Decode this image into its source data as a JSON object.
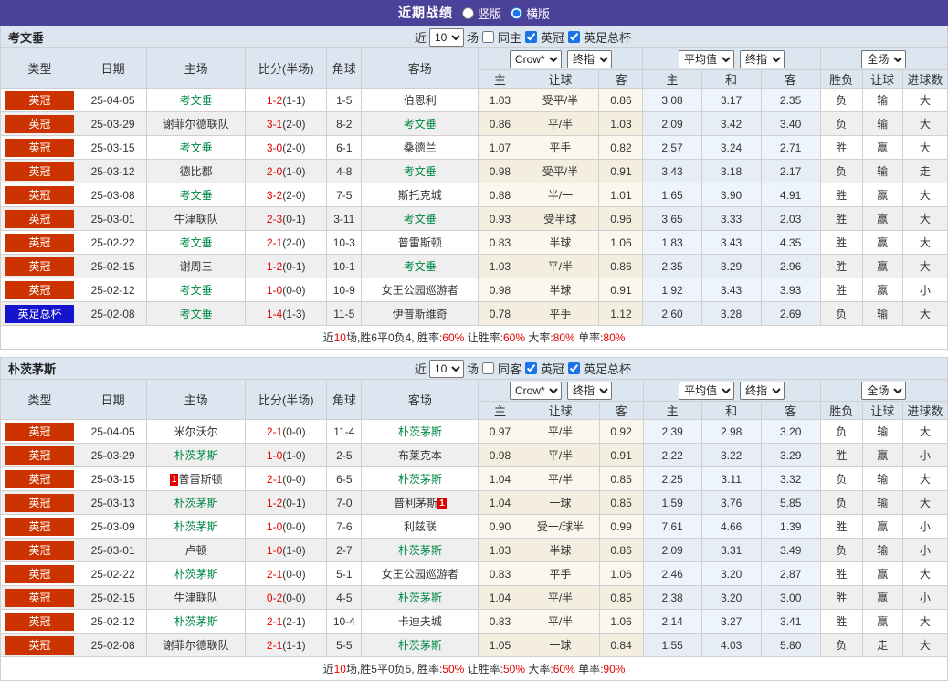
{
  "title_bar": {
    "title": "近期战绩",
    "options": [
      {
        "label": "竖版",
        "selected": false
      },
      {
        "label": "横版",
        "selected": true
      }
    ]
  },
  "colors": {
    "header_purple": "#4c4199",
    "league_badge_red": "#cc3300",
    "cup_badge_blue": "#1414cc",
    "win_red": "#e60000",
    "loss_blue": "#0000cc",
    "push_green": "#009933",
    "team_highlight_green": "#008844"
  },
  "tables": [
    {
      "labels": {
        "team": "考文垂",
        "near_label": "近",
        "near_value": "10",
        "matches_label": "场",
        "same_label": "同主",
        "league_label": "英冠",
        "cup_label": "英足总杯",
        "h_type": "类型",
        "h_date": "日期",
        "h_home": "主场",
        "h_score": "比分(半场)",
        "h_corner": "角球",
        "h_away": "客场",
        "book": "Crow*",
        "book_time": "终指",
        "avg": "平均值",
        "avg_time": "终指",
        "scope": "全场",
        "sub": [
          "主",
          "让球",
          "客",
          "主",
          "和",
          "客",
          "胜负",
          "让球",
          "进球数"
        ]
      },
      "filters": {
        "same_checked": false,
        "league_checked": true,
        "cup_checked": true
      },
      "rows": [
        {
          "type": "英冠",
          "cup": false,
          "date": "25-04-05",
          "home": {
            "name": "考文垂",
            "hl": true
          },
          "ft": "1-2",
          "ht": "(1-1)",
          "corner": "1-5",
          "away": {
            "name": "伯恩利",
            "hl": false
          },
          "odds": [
            "1.03",
            "受平/半",
            "0.86"
          ],
          "avg": [
            "3.08",
            "3.17",
            "2.35"
          ],
          "res": [
            "负",
            "输",
            "大"
          ]
        },
        {
          "type": "英冠",
          "cup": false,
          "date": "25-03-29",
          "home": {
            "name": "谢菲尔德联队",
            "hl": false
          },
          "ft": "3-1",
          "ht": "(2-0)",
          "corner": "8-2",
          "away": {
            "name": "考文垂",
            "hl": true
          },
          "odds": [
            "0.86",
            "平/半",
            "1.03"
          ],
          "avg": [
            "2.09",
            "3.42",
            "3.40"
          ],
          "res": [
            "负",
            "输",
            "大"
          ]
        },
        {
          "type": "英冠",
          "cup": false,
          "date": "25-03-15",
          "home": {
            "name": "考文垂",
            "hl": true
          },
          "ft": "3-0",
          "ht": "(2-0)",
          "corner": "6-1",
          "away": {
            "name": "桑德兰",
            "hl": false
          },
          "odds": [
            "1.07",
            "平手",
            "0.82"
          ],
          "avg": [
            "2.57",
            "3.24",
            "2.71"
          ],
          "res": [
            "胜",
            "赢",
            "大"
          ]
        },
        {
          "type": "英冠",
          "cup": false,
          "date": "25-03-12",
          "home": {
            "name": "德比郡",
            "hl": false
          },
          "ft": "2-0",
          "ht": "(1-0)",
          "corner": "4-8",
          "away": {
            "name": "考文垂",
            "hl": true
          },
          "odds": [
            "0.98",
            "受平/半",
            "0.91"
          ],
          "avg": [
            "3.43",
            "3.18",
            "2.17"
          ],
          "res": [
            "负",
            "输",
            "走"
          ]
        },
        {
          "type": "英冠",
          "cup": false,
          "date": "25-03-08",
          "home": {
            "name": "考文垂",
            "hl": true
          },
          "ft": "3-2",
          "ht": "(2-0)",
          "corner": "7-5",
          "away": {
            "name": "斯托克城",
            "hl": false
          },
          "odds": [
            "0.88",
            "半/一",
            "1.01"
          ],
          "avg": [
            "1.65",
            "3.90",
            "4.91"
          ],
          "res": [
            "胜",
            "赢",
            "大"
          ]
        },
        {
          "type": "英冠",
          "cup": false,
          "date": "25-03-01",
          "home": {
            "name": "牛津联队",
            "hl": false
          },
          "ft": "2-3",
          "ht": "(0-1)",
          "corner": "3-11",
          "away": {
            "name": "考文垂",
            "hl": true
          },
          "odds": [
            "0.93",
            "受半球",
            "0.96"
          ],
          "avg": [
            "3.65",
            "3.33",
            "2.03"
          ],
          "res": [
            "胜",
            "赢",
            "大"
          ]
        },
        {
          "type": "英冠",
          "cup": false,
          "date": "25-02-22",
          "home": {
            "name": "考文垂",
            "hl": true
          },
          "ft": "2-1",
          "ht": "(2-0)",
          "corner": "10-3",
          "away": {
            "name": "普雷斯顿",
            "hl": false
          },
          "odds": [
            "0.83",
            "半球",
            "1.06"
          ],
          "avg": [
            "1.83",
            "3.43",
            "4.35"
          ],
          "res": [
            "胜",
            "赢",
            "大"
          ]
        },
        {
          "type": "英冠",
          "cup": false,
          "date": "25-02-15",
          "home": {
            "name": "谢周三",
            "hl": false
          },
          "ft": "1-2",
          "ht": "(0-1)",
          "corner": "10-1",
          "away": {
            "name": "考文垂",
            "hl": true
          },
          "odds": [
            "1.03",
            "平/半",
            "0.86"
          ],
          "avg": [
            "2.35",
            "3.29",
            "2.96"
          ],
          "res": [
            "胜",
            "赢",
            "大"
          ]
        },
        {
          "type": "英冠",
          "cup": false,
          "date": "25-02-12",
          "home": {
            "name": "考文垂",
            "hl": true
          },
          "ft": "1-0",
          "ht": "(0-0)",
          "corner": "10-9",
          "away": {
            "name": "女王公园巡游者",
            "hl": false
          },
          "odds": [
            "0.98",
            "半球",
            "0.91"
          ],
          "avg": [
            "1.92",
            "3.43",
            "3.93"
          ],
          "res": [
            "胜",
            "赢",
            "小"
          ]
        },
        {
          "type": "英足总杯",
          "cup": true,
          "date": "25-02-08",
          "home": {
            "name": "考文垂",
            "hl": true
          },
          "ft": "1-4",
          "ht": "(1-3)",
          "corner": "11-5",
          "away": {
            "name": "伊普斯维奇",
            "hl": false
          },
          "odds": [
            "0.78",
            "平手",
            "1.12"
          ],
          "avg": [
            "2.60",
            "3.28",
            "2.69"
          ],
          "res": [
            "负",
            "输",
            "大"
          ]
        }
      ],
      "summary": [
        [
          "近",
          "k"
        ],
        [
          "10",
          "r"
        ],
        [
          "场,胜6平0负4, 胜率:",
          "k"
        ],
        [
          "60%",
          "r"
        ],
        [
          " 让胜率:",
          "k"
        ],
        [
          "60%",
          "r"
        ],
        [
          " 大率:",
          "k"
        ],
        [
          "80%",
          "r"
        ],
        [
          " 单率:",
          "k"
        ],
        [
          "80%",
          "r"
        ]
      ]
    },
    {
      "labels": {
        "team": "朴茨茅斯",
        "near_label": "近",
        "near_value": "10",
        "matches_label": "场",
        "same_label": "同客",
        "league_label": "英冠",
        "cup_label": "英足总杯",
        "h_type": "类型",
        "h_date": "日期",
        "h_home": "主场",
        "h_score": "比分(半场)",
        "h_corner": "角球",
        "h_away": "客场",
        "book": "Crow*",
        "book_time": "终指",
        "avg": "平均值",
        "avg_time": "终指",
        "scope": "全场",
        "sub": [
          "主",
          "让球",
          "客",
          "主",
          "和",
          "客",
          "胜负",
          "让球",
          "进球数"
        ]
      },
      "filters": {
        "same_checked": false,
        "league_checked": true,
        "cup_checked": true
      },
      "rows": [
        {
          "type": "英冠",
          "cup": false,
          "date": "25-04-05",
          "home": {
            "name": "米尔沃尔",
            "hl": false
          },
          "ft": "2-1",
          "ht": "(0-0)",
          "corner": "11-4",
          "away": {
            "name": "朴茨茅斯",
            "hl": true
          },
          "odds": [
            "0.97",
            "平/半",
            "0.92"
          ],
          "avg": [
            "2.39",
            "2.98",
            "3.20"
          ],
          "res": [
            "负",
            "输",
            "大"
          ]
        },
        {
          "type": "英冠",
          "cup": false,
          "date": "25-03-29",
          "home": {
            "name": "朴茨茅斯",
            "hl": true
          },
          "ft": "1-0",
          "ht": "(1-0)",
          "corner": "2-5",
          "away": {
            "name": "布莱克本",
            "hl": false
          },
          "odds": [
            "0.98",
            "平/半",
            "0.91"
          ],
          "avg": [
            "2.22",
            "3.22",
            "3.29"
          ],
          "res": [
            "胜",
            "赢",
            "小"
          ]
        },
        {
          "type": "英冠",
          "cup": false,
          "date": "25-03-15",
          "home": {
            "name": "普雷斯顿",
            "hl": false
          },
          "home_badge": "1",
          "ft": "2-1",
          "ht": "(0-0)",
          "corner": "6-5",
          "away": {
            "name": "朴茨茅斯",
            "hl": true
          },
          "odds": [
            "1.04",
            "平/半",
            "0.85"
          ],
          "avg": [
            "2.25",
            "3.11",
            "3.32"
          ],
          "res": [
            "负",
            "输",
            "大"
          ]
        },
        {
          "type": "英冠",
          "cup": false,
          "date": "25-03-13",
          "home": {
            "name": "朴茨茅斯",
            "hl": true
          },
          "ft": "1-2",
          "ht": "(0-1)",
          "corner": "7-0",
          "away": {
            "name": "普利茅斯",
            "hl": false
          },
          "away_badge": "1",
          "odds": [
            "1.04",
            "一球",
            "0.85"
          ],
          "avg": [
            "1.59",
            "3.76",
            "5.85"
          ],
          "res": [
            "负",
            "输",
            "大"
          ]
        },
        {
          "type": "英冠",
          "cup": false,
          "date": "25-03-09",
          "home": {
            "name": "朴茨茅斯",
            "hl": true
          },
          "ft": "1-0",
          "ht": "(0-0)",
          "corner": "7-6",
          "away": {
            "name": "利兹联",
            "hl": false
          },
          "odds": [
            "0.90",
            "受一/球半",
            "0.99"
          ],
          "avg": [
            "7.61",
            "4.66",
            "1.39"
          ],
          "res": [
            "胜",
            "赢",
            "小"
          ]
        },
        {
          "type": "英冠",
          "cup": false,
          "date": "25-03-01",
          "home": {
            "name": "卢顿",
            "hl": false
          },
          "ft": "1-0",
          "ht": "(1-0)",
          "corner": "2-7",
          "away": {
            "name": "朴茨茅斯",
            "hl": true
          },
          "odds": [
            "1.03",
            "半球",
            "0.86"
          ],
          "avg": [
            "2.09",
            "3.31",
            "3.49"
          ],
          "res": [
            "负",
            "输",
            "小"
          ]
        },
        {
          "type": "英冠",
          "cup": false,
          "date": "25-02-22",
          "home": {
            "name": "朴茨茅斯",
            "hl": true
          },
          "ft": "2-1",
          "ht": "(0-0)",
          "corner": "5-1",
          "away": {
            "name": "女王公园巡游者",
            "hl": false
          },
          "odds": [
            "0.83",
            "平手",
            "1.06"
          ],
          "avg": [
            "2.46",
            "3.20",
            "2.87"
          ],
          "res": [
            "胜",
            "赢",
            "大"
          ]
        },
        {
          "type": "英冠",
          "cup": false,
          "date": "25-02-15",
          "home": {
            "name": "牛津联队",
            "hl": false
          },
          "ft": "0-2",
          "ht": "(0-0)",
          "corner": "4-5",
          "away": {
            "name": "朴茨茅斯",
            "hl": true
          },
          "odds": [
            "1.04",
            "平/半",
            "0.85"
          ],
          "avg": [
            "2.38",
            "3.20",
            "3.00"
          ],
          "res": [
            "胜",
            "赢",
            "小"
          ]
        },
        {
          "type": "英冠",
          "cup": false,
          "date": "25-02-12",
          "home": {
            "name": "朴茨茅斯",
            "hl": true
          },
          "ft": "2-1",
          "ht": "(2-1)",
          "corner": "10-4",
          "away": {
            "name": "卡迪夫城",
            "hl": false
          },
          "odds": [
            "0.83",
            "平/半",
            "1.06"
          ],
          "avg": [
            "2.14",
            "3.27",
            "3.41"
          ],
          "res": [
            "胜",
            "赢",
            "大"
          ]
        },
        {
          "type": "英冠",
          "cup": false,
          "date": "25-02-08",
          "home": {
            "name": "谢菲尔德联队",
            "hl": false
          },
          "ft": "2-1",
          "ht": "(1-1)",
          "corner": "5-5",
          "away": {
            "name": "朴茨茅斯",
            "hl": true
          },
          "odds": [
            "1.05",
            "一球",
            "0.84"
          ],
          "avg": [
            "1.55",
            "4.03",
            "5.80"
          ],
          "res": [
            "负",
            "走",
            "大"
          ]
        }
      ],
      "summary": [
        [
          "近",
          "k"
        ],
        [
          "10",
          "r"
        ],
        [
          "场,胜5平0负5, 胜率:",
          "k"
        ],
        [
          "50%",
          "r"
        ],
        [
          " 让胜率:",
          "k"
        ],
        [
          "50%",
          "r"
        ],
        [
          " 大率:",
          "k"
        ],
        [
          "60%",
          "r"
        ],
        [
          " 单率:",
          "k"
        ],
        [
          "90%",
          "r"
        ]
      ]
    }
  ]
}
